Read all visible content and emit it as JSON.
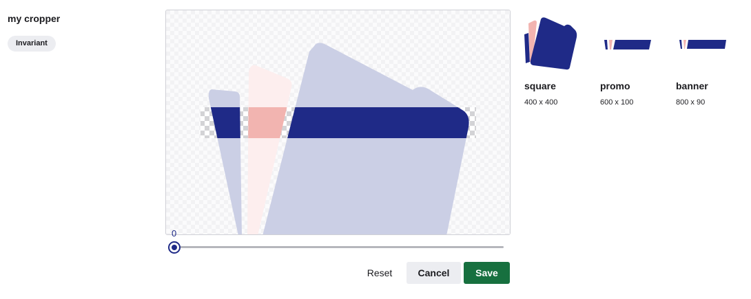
{
  "cropper": {
    "title": "my cropper",
    "tag": "Invariant"
  },
  "slider": {
    "value": "0"
  },
  "buttons": {
    "reset": "Reset",
    "cancel": "Cancel",
    "save": "Save"
  },
  "previews": [
    {
      "name": "square",
      "size": "400 x 400"
    },
    {
      "name": "promo",
      "size": "600 x 100"
    },
    {
      "name": "banner",
      "size": "800 x 90"
    }
  ],
  "colors": {
    "navy": "#1f2a87",
    "light_navy": "#cbcfe5",
    "pink": "#f2b4b0",
    "light_pink": "#fdeeee",
    "save_green": "#17703f"
  }
}
